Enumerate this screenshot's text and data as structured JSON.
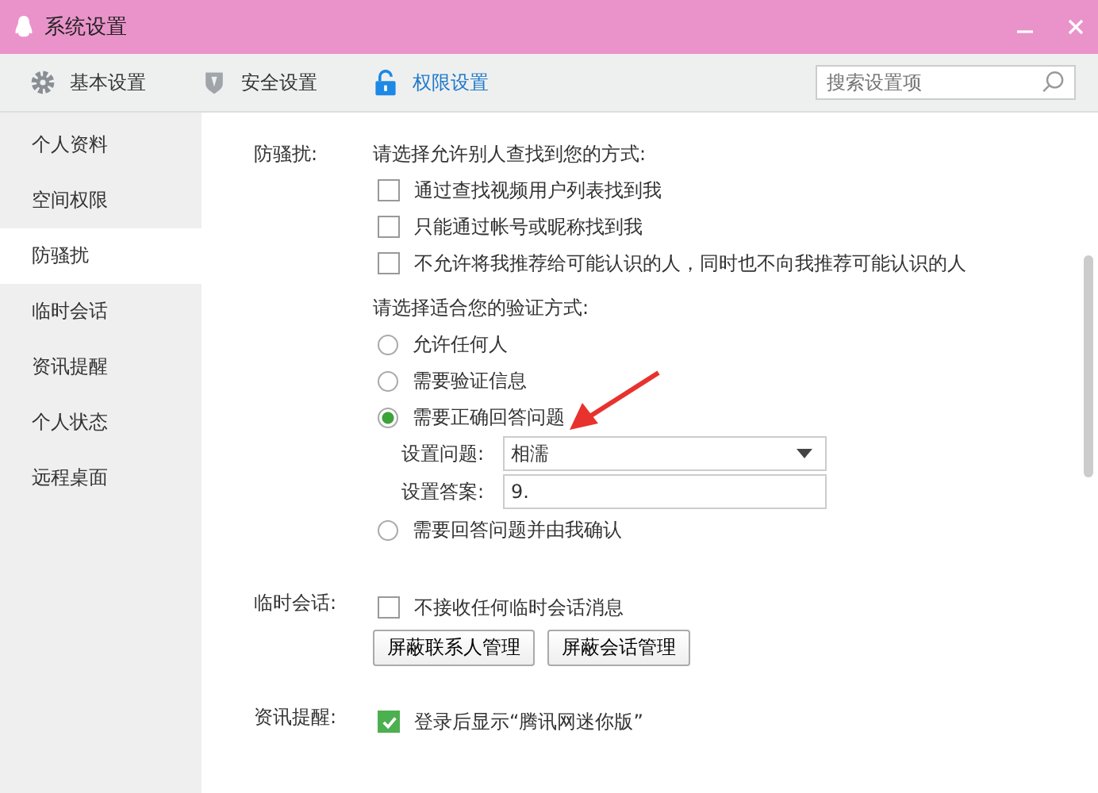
{
  "window": {
    "title": "系统设置"
  },
  "tabs": [
    {
      "label": "基本设置",
      "kind": "gear",
      "selected": false
    },
    {
      "label": "安全设置",
      "kind": "shield",
      "selected": false
    },
    {
      "label": "权限设置",
      "kind": "lock",
      "selected": true
    }
  ],
  "search": {
    "placeholder": "搜索设置项"
  },
  "sidebar": {
    "items": [
      {
        "label": "个人资料",
        "selected": false
      },
      {
        "label": "空间权限",
        "selected": false
      },
      {
        "label": "防骚扰",
        "selected": true
      },
      {
        "label": "临时会话",
        "selected": false
      },
      {
        "label": "资讯提醒",
        "selected": false
      },
      {
        "label": "个人状态",
        "selected": false
      },
      {
        "label": "远程桌面",
        "selected": false
      }
    ]
  },
  "anti_harass": {
    "label": "防骚扰:",
    "find_prompt": "请选择允许别人查找到您的方式:",
    "find_options": [
      {
        "label": "通过查找视频用户列表找到我",
        "checked": false
      },
      {
        "label": "只能通过帐号或昵称找到我",
        "checked": false
      },
      {
        "label": "不允许将我推荐给可能认识的人，同时也不向我推荐可能认识的人",
        "checked": false
      }
    ],
    "verify_prompt": "请选择适合您的验证方式:",
    "verify_options": [
      {
        "label": "允许任何人",
        "selected": false
      },
      {
        "label": "需要验证信息",
        "selected": false
      },
      {
        "label": "需要正确回答问题",
        "selected": true,
        "question_label": "设置问题:",
        "question_value": "相濡",
        "answer_label": "设置答案:",
        "answer_value": "9."
      },
      {
        "label": "需要回答问题并由我确认",
        "selected": false
      }
    ]
  },
  "temp_chat": {
    "label": "临时会话:",
    "option": {
      "label": "不接收任何临时会话消息",
      "checked": false
    },
    "buttons": [
      "屏蔽联系人管理",
      "屏蔽会话管理"
    ]
  },
  "news": {
    "label": "资讯提醒:",
    "option": {
      "label": "登录后显示“腾讯网迷你版”",
      "checked": true
    }
  }
}
